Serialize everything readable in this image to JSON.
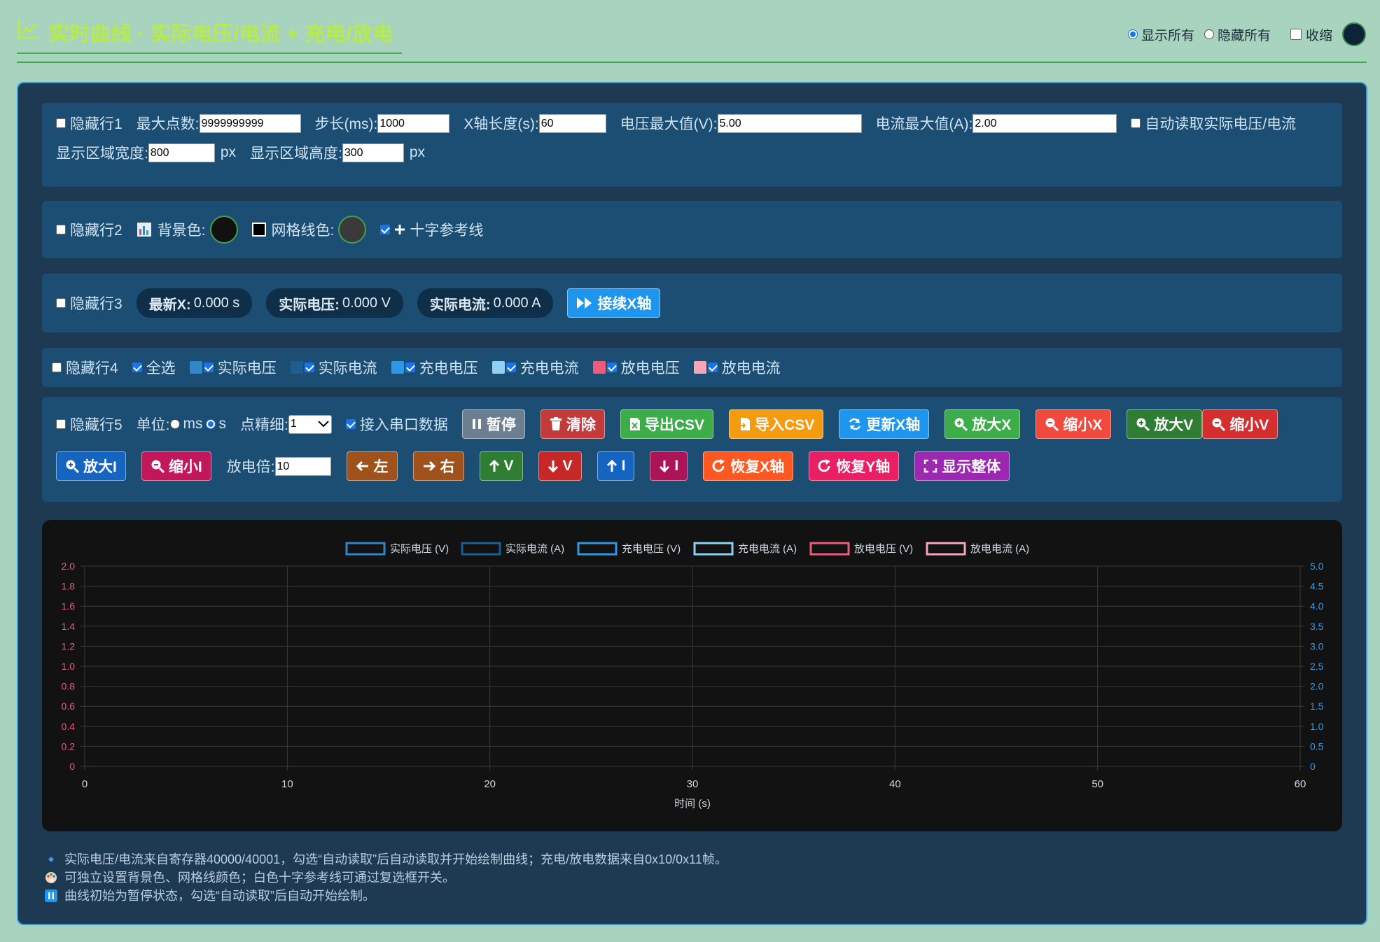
{
  "header": {
    "title": "实时曲线 · 实际电压/电流 + 充电/放电",
    "show_all": "显示所有",
    "hide_all": "隐藏所有",
    "collapse": "收缩",
    "swatch_color": "#0c2338"
  },
  "row1": {
    "hide": "隐藏行1",
    "max_points_label": "最大点数:",
    "max_points": "9999999999",
    "step_label": "步长(ms):",
    "step": "1000",
    "xlen_label": "X轴长度(s):",
    "xlen": "60",
    "vmax_label": "电压最大值(V):",
    "vmax": "5.00",
    "imax_label": "电流最大值(A):",
    "imax": "2.00",
    "auto_read": "自动读取实际电压/电流",
    "width_label": "显示区域宽度:",
    "width": "800",
    "height_label": "显示区域高度:",
    "height": "300",
    "px": "px"
  },
  "row2": {
    "hide": "隐藏行2",
    "bg_label": "背景色:",
    "bg_color": "#111111",
    "grid_label": "网格线色:",
    "grid_color": "#3a3a3a",
    "crosshair": "十字参考线"
  },
  "row3": {
    "hide": "隐藏行3",
    "latest_x_label": "最新X:",
    "latest_x": "0.000 s",
    "volt_label": "实际电压:",
    "volt": "0.000 V",
    "curr_label": "实际电流:",
    "curr": "0.000 A",
    "continue_x": "接续X轴"
  },
  "row4": {
    "hide": "隐藏行4",
    "select_all": "全选",
    "series": [
      {
        "label": "实际电压",
        "color": "#2f86c8"
      },
      {
        "label": "实际电流",
        "color": "#1b5f92"
      },
      {
        "label": "充电电压",
        "color": "#2e98e6"
      },
      {
        "label": "充电电流",
        "color": "#8fd0f5"
      },
      {
        "label": "放电电压",
        "color": "#ee5a7a"
      },
      {
        "label": "放电电流",
        "color": "#f6a6b8"
      }
    ]
  },
  "row5": {
    "hide": "隐藏行5",
    "unit_label": "单位:",
    "unit_ms": "ms",
    "unit_s": "s",
    "precision_label": "点精细:",
    "precision": "1",
    "serial": "接入串口数据",
    "pause": "暂停",
    "clear": "清除",
    "export_csv": "导出CSV",
    "import_csv": "导入CSV",
    "update_x": "更新X轴",
    "zoom_in_x": "放大X",
    "zoom_out_x": "缩小X",
    "zoom_in_v": "放大V",
    "zoom_out_v": "缩小V",
    "zoom_in_i": "放大I",
    "zoom_out_i": "缩小I",
    "factor_label": "放电倍:",
    "factor": "10",
    "left": "左",
    "right": "右",
    "v_up": "V",
    "v_down": "V",
    "i_up": "I",
    "i_down": "I",
    "reset_x": "恢复X轴",
    "reset_y": "恢复Y轴",
    "show_all": "显示整体"
  },
  "chart_data": {
    "type": "line",
    "title": "",
    "xlabel": "时间 (s)",
    "xlim": [
      0,
      60
    ],
    "x_ticks": [
      "0",
      "10",
      "20",
      "30",
      "40",
      "50",
      "60"
    ],
    "y_left_lim": [
      0,
      2.0
    ],
    "y_left_ticks": [
      "0",
      "0.2",
      "0.4",
      "0.6",
      "0.8",
      "1.0",
      "1.2",
      "1.4",
      "1.6",
      "1.8",
      "2.0"
    ],
    "y_right_lim": [
      0,
      5.0
    ],
    "y_right_ticks": [
      "0",
      "0.5",
      "1.0",
      "1.5",
      "2.0",
      "2.5",
      "3.0",
      "3.5",
      "4.0",
      "4.5",
      "5.0"
    ],
    "grid": true,
    "legend_position": "top",
    "series": [
      {
        "name": "实际电压 (V)",
        "color": "#2f86c8",
        "values": []
      },
      {
        "name": "实际电流 (A)",
        "color": "#1b5f92",
        "values": []
      },
      {
        "name": "充电电压 (V)",
        "color": "#2e98e6",
        "values": []
      },
      {
        "name": "充电电流 (A)",
        "color": "#8fd0f5",
        "values": []
      },
      {
        "name": "放电电压 (V)",
        "color": "#ee5a7a",
        "values": []
      },
      {
        "name": "放电电流 (A)",
        "color": "#f6a6b8",
        "values": []
      }
    ]
  },
  "notes": [
    "实际电压/电流来自寄存器40000/40001，勾选“自动读取”后自动读取并开始绘制曲线；充电/放电数据来自0x10/0x11帧。",
    "可独立设置背景色、网格线颜色；白色十字参考线可通过复选框开关。",
    "曲线初始为暂停状态，勾选“自动读取”后自动开始绘制。"
  ]
}
